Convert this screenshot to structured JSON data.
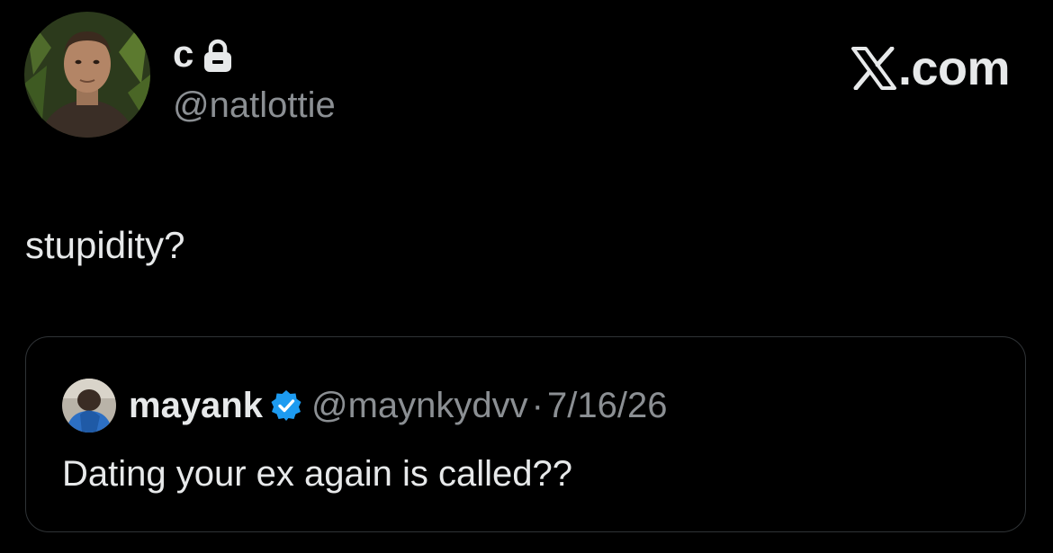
{
  "author": {
    "display_name": "c",
    "handle": "@natlottie",
    "avatar_icon": "profile-photo",
    "protected_icon": "lock-icon"
  },
  "brand": {
    "logo_icon": "x-logo-icon",
    "domain": ".com"
  },
  "tweet": {
    "text": "stupidity?"
  },
  "quoted_tweet": {
    "display_name": "mayank",
    "verified_icon": "verified-badge-icon",
    "verified_color": "#1d9bf0",
    "handle": "@maynkydvv",
    "separator": "·",
    "date": "7/16/26",
    "text": "Dating your ex again is called??"
  },
  "colors": {
    "background": "#000000",
    "primary_text": "#e7e9ea",
    "secondary_text": "#8b8f93",
    "card_border": "#2f3336"
  }
}
